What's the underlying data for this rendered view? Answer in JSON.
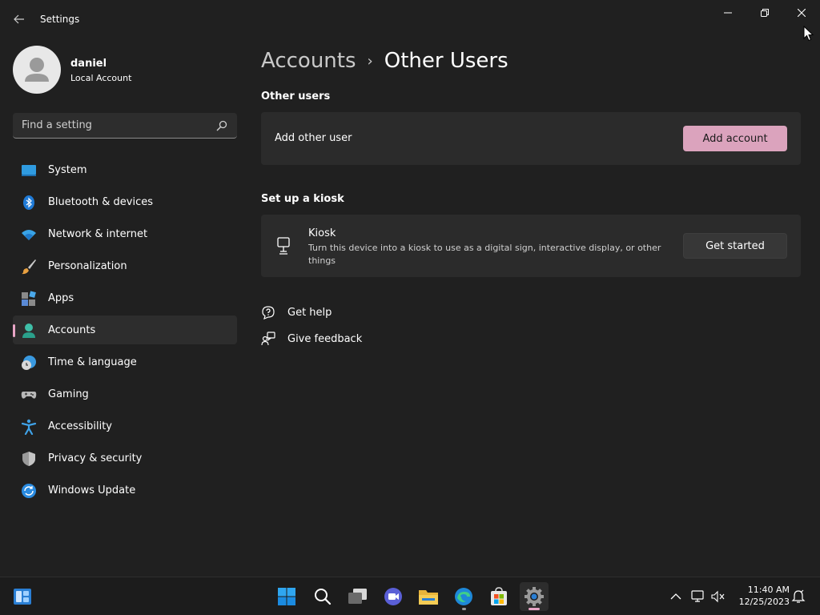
{
  "window": {
    "title": "Settings"
  },
  "profile": {
    "name": "daniel",
    "account_type": "Local Account"
  },
  "search": {
    "placeholder": "Find a setting"
  },
  "sidebar": {
    "items": [
      {
        "label": "System",
        "icon": "system-icon"
      },
      {
        "label": "Bluetooth & devices",
        "icon": "bluetooth-icon"
      },
      {
        "label": "Network & internet",
        "icon": "wifi-icon"
      },
      {
        "label": "Personalization",
        "icon": "brush-icon"
      },
      {
        "label": "Apps",
        "icon": "apps-icon"
      },
      {
        "label": "Accounts",
        "icon": "accounts-icon",
        "active": true
      },
      {
        "label": "Time & language",
        "icon": "clock-globe-icon"
      },
      {
        "label": "Gaming",
        "icon": "gamepad-icon"
      },
      {
        "label": "Accessibility",
        "icon": "accessibility-icon"
      },
      {
        "label": "Privacy & security",
        "icon": "shield-icon"
      },
      {
        "label": "Windows Update",
        "icon": "update-icon"
      }
    ]
  },
  "breadcrumb": {
    "parent": "Accounts",
    "separator": "›",
    "current": "Other Users"
  },
  "other_users": {
    "section_title": "Other users",
    "row_label": "Add other user",
    "button_label": "Add account"
  },
  "kiosk": {
    "section_title": "Set up a kiosk",
    "title": "Kiosk",
    "description": "Turn this device into a kiosk to use as a digital sign, interactive display, or other things",
    "button_label": "Get started"
  },
  "links": {
    "get_help": "Get help",
    "give_feedback": "Give feedback"
  },
  "taskbar": {
    "apps": [
      "widgets-icon",
      "start-icon",
      "search-icon",
      "task-view-icon",
      "teams-chat-icon",
      "file-explorer-icon",
      "edge-icon",
      "store-icon",
      "settings-icon"
    ]
  },
  "clock": {
    "time": "11:40 AM",
    "date": "12/25/2023"
  },
  "colors": {
    "accent": "#dba3bd",
    "background": "#202020",
    "card": "#2b2b2b"
  }
}
